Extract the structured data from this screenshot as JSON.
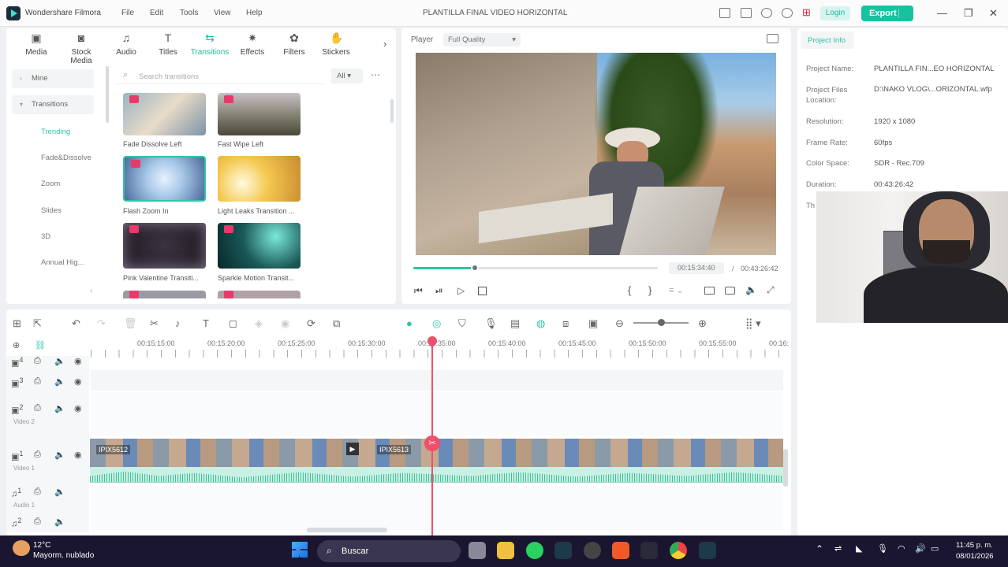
{
  "app": {
    "title": "Wondershare Filmora",
    "project_title": "PLANTILLA FINAL VIDEO HORIZONTAL",
    "login": "Login",
    "export": "Export"
  },
  "menu": [
    "File",
    "Edit",
    "Tools",
    "View",
    "Help"
  ],
  "toolbar": [
    {
      "label": "Media",
      "icon": "media-icon"
    },
    {
      "label": "Stock Media",
      "icon": "stock-media-icon"
    },
    {
      "label": "Audio",
      "icon": "music-icon"
    },
    {
      "label": "Titles",
      "icon": "text-icon"
    },
    {
      "label": "Transitions",
      "icon": "transitions-icon"
    },
    {
      "label": "Effects",
      "icon": "effects-icon"
    },
    {
      "label": "Filters",
      "icon": "filters-icon"
    },
    {
      "label": "Stickers",
      "icon": "stickers-icon"
    }
  ],
  "sidebar": {
    "mine": "Mine",
    "transitions": "Transitions",
    "items": [
      "Trending",
      "Fade&Dissolve",
      "Zoom",
      "Slides",
      "3D",
      "Annual Hig..."
    ]
  },
  "search": {
    "placeholder": "Search transitions",
    "filter": "All"
  },
  "transitions": [
    {
      "label": "Fade Dissolve Left"
    },
    {
      "label": "Fast Wipe Left"
    },
    {
      "label": "Flash Zoom In"
    },
    {
      "label": "Light Leaks Transition ..."
    },
    {
      "label": "Pink Valentine Transiti..."
    },
    {
      "label": "Sparkle Motion Transit..."
    }
  ],
  "player": {
    "label": "Player",
    "quality": "Full Quality",
    "current_time": "00:15:34:40",
    "separator": "/",
    "total_time": "00:43:26:42",
    "progress": 0.25
  },
  "project_info": {
    "tab": "Project Info",
    "rows": [
      {
        "k": "Project Name:",
        "v": "PLANTILLA FIN...EO HORIZONTAL"
      },
      {
        "k": "Project Files Location:",
        "v": "D:\\NAKO VLOG\\...ORIZONTAL.wfp"
      },
      {
        "k": "Resolution:",
        "v": "1920 x 1080"
      },
      {
        "k": "Frame Rate:",
        "v": "60fps"
      },
      {
        "k": "Color Space:",
        "v": "SDR - Rec.709"
      },
      {
        "k": "Duration:",
        "v": "00:43:26:42"
      }
    ],
    "partial": "Th"
  },
  "ruler": [
    "00:15:15:00",
    "00:15:20:00",
    "00:15:25:00",
    "00:15:30:00",
    "00:15:35:00",
    "00:15:40:00",
    "00:15:45:00",
    "00:15:50:00",
    "00:15:55:00",
    "00:16:"
  ],
  "tracks": {
    "video2": "Video 2",
    "video1": "Video 1",
    "audio1": "Audio 1",
    "t4": "4",
    "t3": "3",
    "t2": "2",
    "t1": "1",
    "a2": "2",
    "clip1": "IPIX5612",
    "clip2": "IPIX5613"
  },
  "taskbar": {
    "temp": "12°C",
    "weather": "Mayorm. nublado",
    "search": "Buscar",
    "time": "11:45 p. m.",
    "date": "08/01/2026"
  }
}
